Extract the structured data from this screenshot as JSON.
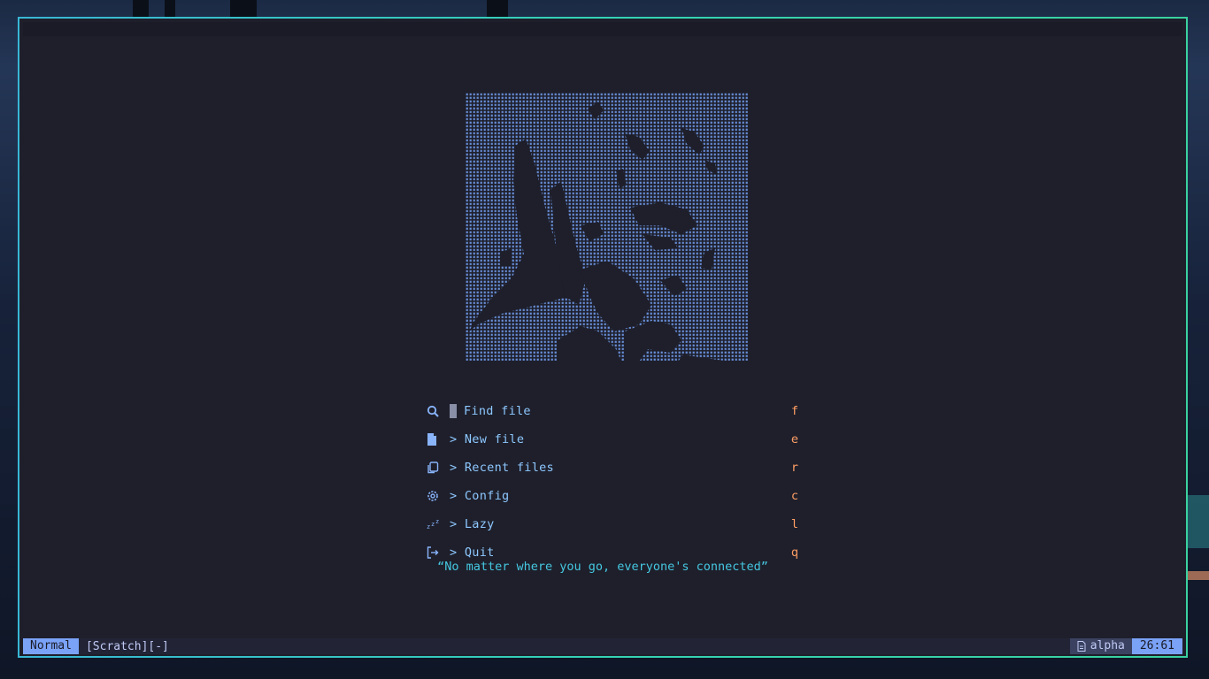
{
  "menu": [
    {
      "icon": "search-icon",
      "label": "Find file",
      "key": "f"
    },
    {
      "icon": "file-icon",
      "label": "> New file",
      "key": "e"
    },
    {
      "icon": "copy-icon",
      "label": "> Recent files",
      "key": "r"
    },
    {
      "icon": "gear-icon",
      "label": "> Config",
      "key": "c"
    },
    {
      "icon": "sleep-icon",
      "label": "> Lazy",
      "key": "l"
    },
    {
      "icon": "exit-icon",
      "label": "> Quit",
      "key": "q"
    }
  ],
  "quote": "“No matter where you go, everyone's connected”",
  "statusline": {
    "mode": "Normal",
    "buffer": "[Scratch][-]",
    "filetype": "alpha",
    "position": "26:61"
  },
  "colors": {
    "accent_blue": "#7aa2f7",
    "key_orange": "#ff9e64",
    "quote_cyan": "#45c7e0",
    "label_blue": "#8ec8ff",
    "border_teal": "#34d3b5",
    "editor_bg": "#1e1f2b",
    "art_dots": "#6b93e0"
  }
}
